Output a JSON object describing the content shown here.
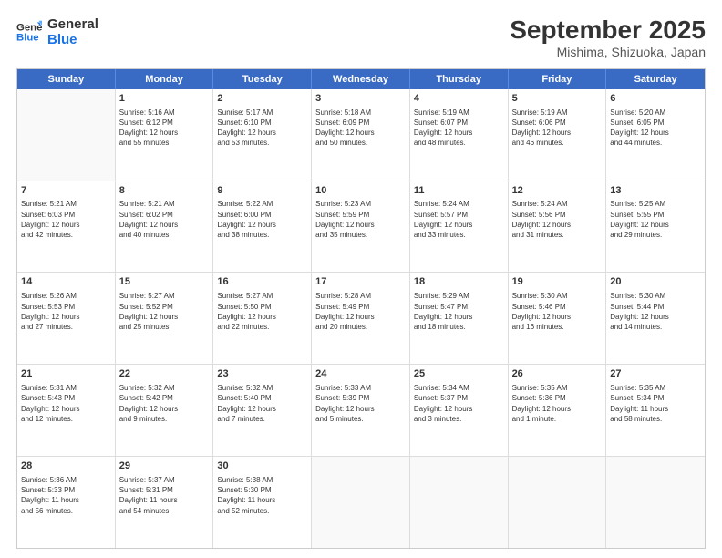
{
  "header": {
    "logo_line1": "General",
    "logo_line2": "Blue",
    "title": "September 2025",
    "subtitle": "Mishima, Shizuoka, Japan"
  },
  "weekdays": [
    "Sunday",
    "Monday",
    "Tuesday",
    "Wednesday",
    "Thursday",
    "Friday",
    "Saturday"
  ],
  "weeks": [
    [
      {
        "day": "",
        "text": ""
      },
      {
        "day": "1",
        "text": "Sunrise: 5:16 AM\nSunset: 6:12 PM\nDaylight: 12 hours\nand 55 minutes."
      },
      {
        "day": "2",
        "text": "Sunrise: 5:17 AM\nSunset: 6:10 PM\nDaylight: 12 hours\nand 53 minutes."
      },
      {
        "day": "3",
        "text": "Sunrise: 5:18 AM\nSunset: 6:09 PM\nDaylight: 12 hours\nand 50 minutes."
      },
      {
        "day": "4",
        "text": "Sunrise: 5:19 AM\nSunset: 6:07 PM\nDaylight: 12 hours\nand 48 minutes."
      },
      {
        "day": "5",
        "text": "Sunrise: 5:19 AM\nSunset: 6:06 PM\nDaylight: 12 hours\nand 46 minutes."
      },
      {
        "day": "6",
        "text": "Sunrise: 5:20 AM\nSunset: 6:05 PM\nDaylight: 12 hours\nand 44 minutes."
      }
    ],
    [
      {
        "day": "7",
        "text": "Sunrise: 5:21 AM\nSunset: 6:03 PM\nDaylight: 12 hours\nand 42 minutes."
      },
      {
        "day": "8",
        "text": "Sunrise: 5:21 AM\nSunset: 6:02 PM\nDaylight: 12 hours\nand 40 minutes."
      },
      {
        "day": "9",
        "text": "Sunrise: 5:22 AM\nSunset: 6:00 PM\nDaylight: 12 hours\nand 38 minutes."
      },
      {
        "day": "10",
        "text": "Sunrise: 5:23 AM\nSunset: 5:59 PM\nDaylight: 12 hours\nand 35 minutes."
      },
      {
        "day": "11",
        "text": "Sunrise: 5:24 AM\nSunset: 5:57 PM\nDaylight: 12 hours\nand 33 minutes."
      },
      {
        "day": "12",
        "text": "Sunrise: 5:24 AM\nSunset: 5:56 PM\nDaylight: 12 hours\nand 31 minutes."
      },
      {
        "day": "13",
        "text": "Sunrise: 5:25 AM\nSunset: 5:55 PM\nDaylight: 12 hours\nand 29 minutes."
      }
    ],
    [
      {
        "day": "14",
        "text": "Sunrise: 5:26 AM\nSunset: 5:53 PM\nDaylight: 12 hours\nand 27 minutes."
      },
      {
        "day": "15",
        "text": "Sunrise: 5:27 AM\nSunset: 5:52 PM\nDaylight: 12 hours\nand 25 minutes."
      },
      {
        "day": "16",
        "text": "Sunrise: 5:27 AM\nSunset: 5:50 PM\nDaylight: 12 hours\nand 22 minutes."
      },
      {
        "day": "17",
        "text": "Sunrise: 5:28 AM\nSunset: 5:49 PM\nDaylight: 12 hours\nand 20 minutes."
      },
      {
        "day": "18",
        "text": "Sunrise: 5:29 AM\nSunset: 5:47 PM\nDaylight: 12 hours\nand 18 minutes."
      },
      {
        "day": "19",
        "text": "Sunrise: 5:30 AM\nSunset: 5:46 PM\nDaylight: 12 hours\nand 16 minutes."
      },
      {
        "day": "20",
        "text": "Sunrise: 5:30 AM\nSunset: 5:44 PM\nDaylight: 12 hours\nand 14 minutes."
      }
    ],
    [
      {
        "day": "21",
        "text": "Sunrise: 5:31 AM\nSunset: 5:43 PM\nDaylight: 12 hours\nand 12 minutes."
      },
      {
        "day": "22",
        "text": "Sunrise: 5:32 AM\nSunset: 5:42 PM\nDaylight: 12 hours\nand 9 minutes."
      },
      {
        "day": "23",
        "text": "Sunrise: 5:32 AM\nSunset: 5:40 PM\nDaylight: 12 hours\nand 7 minutes."
      },
      {
        "day": "24",
        "text": "Sunrise: 5:33 AM\nSunset: 5:39 PM\nDaylight: 12 hours\nand 5 minutes."
      },
      {
        "day": "25",
        "text": "Sunrise: 5:34 AM\nSunset: 5:37 PM\nDaylight: 12 hours\nand 3 minutes."
      },
      {
        "day": "26",
        "text": "Sunrise: 5:35 AM\nSunset: 5:36 PM\nDaylight: 12 hours\nand 1 minute."
      },
      {
        "day": "27",
        "text": "Sunrise: 5:35 AM\nSunset: 5:34 PM\nDaylight: 11 hours\nand 58 minutes."
      }
    ],
    [
      {
        "day": "28",
        "text": "Sunrise: 5:36 AM\nSunset: 5:33 PM\nDaylight: 11 hours\nand 56 minutes."
      },
      {
        "day": "29",
        "text": "Sunrise: 5:37 AM\nSunset: 5:31 PM\nDaylight: 11 hours\nand 54 minutes."
      },
      {
        "day": "30",
        "text": "Sunrise: 5:38 AM\nSunset: 5:30 PM\nDaylight: 11 hours\nand 52 minutes."
      },
      {
        "day": "",
        "text": ""
      },
      {
        "day": "",
        "text": ""
      },
      {
        "day": "",
        "text": ""
      },
      {
        "day": "",
        "text": ""
      }
    ]
  ]
}
